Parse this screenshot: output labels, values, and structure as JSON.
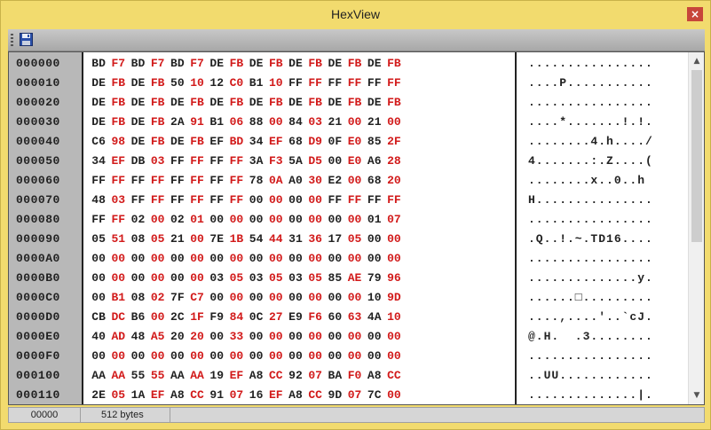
{
  "window": {
    "title": "HexView",
    "close_label": "×"
  },
  "toolbar": {
    "save_icon": "save-icon"
  },
  "status": {
    "position": "00000",
    "size": "512 bytes"
  },
  "colors": {
    "byte_high": "#d21a1a",
    "byte_low": "#222222",
    "address_bg": "#b8b8b8",
    "frame": "#f2db6e"
  },
  "rows": [
    {
      "addr": "000000",
      "bytes": [
        "BD",
        "F7",
        "BD",
        "F7",
        "BD",
        "F7",
        "DE",
        "FB",
        "DE",
        "FB",
        "DE",
        "FB",
        "DE",
        "FB",
        "DE",
        "FB"
      ],
      "ascii": "................"
    },
    {
      "addr": "000010",
      "bytes": [
        "DE",
        "FB",
        "DE",
        "FB",
        "50",
        "10",
        "12",
        "C0",
        "B1",
        "10",
        "FF",
        "FF",
        "FF",
        "FF",
        "FF",
        "FF"
      ],
      "ascii": "....P..........."
    },
    {
      "addr": "000020",
      "bytes": [
        "DE",
        "FB",
        "DE",
        "FB",
        "DE",
        "FB",
        "DE",
        "FB",
        "DE",
        "FB",
        "DE",
        "FB",
        "DE",
        "FB",
        "DE",
        "FB"
      ],
      "ascii": "................"
    },
    {
      "addr": "000030",
      "bytes": [
        "DE",
        "FB",
        "DE",
        "FB",
        "2A",
        "91",
        "B1",
        "06",
        "88",
        "00",
        "84",
        "03",
        "21",
        "00",
        "21",
        "00"
      ],
      "ascii": "....*.......!.!."
    },
    {
      "addr": "000040",
      "bytes": [
        "C6",
        "98",
        "DE",
        "FB",
        "DE",
        "FB",
        "EF",
        "BD",
        "34",
        "EF",
        "68",
        "D9",
        "0F",
        "E0",
        "85",
        "2F"
      ],
      "ascii": "........4.h..../"
    },
    {
      "addr": "000050",
      "bytes": [
        "34",
        "EF",
        "DB",
        "03",
        "FF",
        "FF",
        "FF",
        "FF",
        "3A",
        "F3",
        "5A",
        "D5",
        "00",
        "E0",
        "A6",
        "28"
      ],
      "ascii": "4.......:.Z....("
    },
    {
      "addr": "000060",
      "bytes": [
        "FF",
        "FF",
        "FF",
        "FF",
        "FF",
        "FF",
        "FF",
        "FF",
        "78",
        "0A",
        "A0",
        "30",
        "E2",
        "00",
        "68",
        "20"
      ],
      "ascii": "........x..0..h "
    },
    {
      "addr": "000070",
      "bytes": [
        "48",
        "03",
        "FF",
        "FF",
        "FF",
        "FF",
        "FF",
        "FF",
        "00",
        "00",
        "00",
        "00",
        "FF",
        "FF",
        "FF",
        "FF"
      ],
      "ascii": "H..............."
    },
    {
      "addr": "000080",
      "bytes": [
        "FF",
        "FF",
        "02",
        "00",
        "02",
        "01",
        "00",
        "00",
        "00",
        "00",
        "00",
        "00",
        "00",
        "00",
        "01",
        "07"
      ],
      "ascii": "................"
    },
    {
      "addr": "000090",
      "bytes": [
        "05",
        "51",
        "08",
        "05",
        "21",
        "00",
        "7E",
        "1B",
        "54",
        "44",
        "31",
        "36",
        "17",
        "05",
        "00",
        "00"
      ],
      "ascii": ".Q..!.~.TD16...."
    },
    {
      "addr": "0000A0",
      "bytes": [
        "00",
        "00",
        "00",
        "00",
        "00",
        "00",
        "00",
        "00",
        "00",
        "00",
        "00",
        "00",
        "00",
        "00",
        "00",
        "00"
      ],
      "ascii": "................"
    },
    {
      "addr": "0000B0",
      "bytes": [
        "00",
        "00",
        "00",
        "00",
        "00",
        "00",
        "03",
        "05",
        "03",
        "05",
        "03",
        "05",
        "85",
        "AE",
        "79",
        "96"
      ],
      "ascii": "..............y."
    },
    {
      "addr": "0000C0",
      "bytes": [
        "00",
        "B1",
        "08",
        "02",
        "7F",
        "C7",
        "00",
        "00",
        "00",
        "00",
        "00",
        "00",
        "00",
        "00",
        "10",
        "9D"
      ],
      "ascii": "......□........."
    },
    {
      "addr": "0000D0",
      "bytes": [
        "CB",
        "DC",
        "B6",
        "00",
        "2C",
        "1F",
        "F9",
        "84",
        "0C",
        "27",
        "E9",
        "F6",
        "60",
        "63",
        "4A",
        "10"
      ],
      "ascii": "....,....'..`cJ."
    },
    {
      "addr": "0000E0",
      "bytes": [
        "40",
        "AD",
        "48",
        "A5",
        "20",
        "20",
        "00",
        "33",
        "00",
        "00",
        "00",
        "00",
        "00",
        "00",
        "00",
        "00"
      ],
      "ascii": "@.H.  .3........"
    },
    {
      "addr": "0000F0",
      "bytes": [
        "00",
        "00",
        "00",
        "00",
        "00",
        "00",
        "00",
        "00",
        "00",
        "00",
        "00",
        "00",
        "00",
        "00",
        "00",
        "00"
      ],
      "ascii": "................"
    },
    {
      "addr": "000100",
      "bytes": [
        "AA",
        "AA",
        "55",
        "55",
        "AA",
        "AA",
        "19",
        "EF",
        "A8",
        "CC",
        "92",
        "07",
        "BA",
        "F0",
        "A8",
        "CC"
      ],
      "ascii": "..UU............"
    },
    {
      "addr": "000110",
      "bytes": [
        "2E",
        "05",
        "1A",
        "EF",
        "A8",
        "CC",
        "91",
        "07",
        "16",
        "EF",
        "A8",
        "CC",
        "9D",
        "07",
        "7C",
        "00"
      ],
      "ascii": "..............|."
    }
  ]
}
